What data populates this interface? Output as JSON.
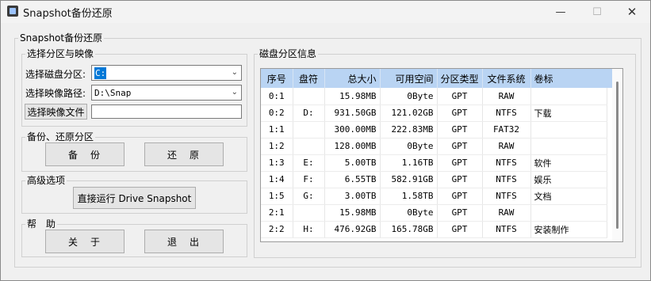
{
  "window": {
    "title": "Snapshot备份还原",
    "min_glyph": "—",
    "max_glyph": "☐",
    "close_glyph": "✕"
  },
  "main_group_title": "Snapshot备份还原",
  "select_group": {
    "title": "选择分区与映像",
    "partition_label": "选择磁盘分区:",
    "partition_value": "C:",
    "image_path_label": "选择映像路径:",
    "image_path_value": "D:\\Snap",
    "choose_file_button": "选择映像文件",
    "file_value": ""
  },
  "backup_group": {
    "title": "备份、还原分区",
    "backup_button": "备　份",
    "restore_button": "还　原"
  },
  "advanced_group": {
    "title": "高级选项",
    "run_button": "直接运行 Drive Snapshot"
  },
  "help_group": {
    "title": "帮　助",
    "about_button": "关　于",
    "exit_button": "退　出"
  },
  "disk_group": {
    "title": "磁盘分区信息",
    "columns": [
      "序号",
      "盘符",
      "总大小",
      "可用空间",
      "分区类型",
      "文件系统",
      "卷标"
    ],
    "rows": [
      [
        "0:1",
        "",
        "15.98MB",
        "0Byte",
        "GPT",
        "RAW",
        ""
      ],
      [
        "0:2",
        "D:",
        "931.50GB",
        "121.02GB",
        "GPT",
        "NTFS",
        "下载"
      ],
      [
        "1:1",
        "",
        "300.00MB",
        "222.83MB",
        "GPT",
        "FAT32",
        ""
      ],
      [
        "1:2",
        "",
        "128.00MB",
        "0Byte",
        "GPT",
        "RAW",
        ""
      ],
      [
        "1:3",
        "E:",
        "5.00TB",
        "1.16TB",
        "GPT",
        "NTFS",
        "软件"
      ],
      [
        "1:4",
        "F:",
        "6.55TB",
        "582.91GB",
        "GPT",
        "NTFS",
        "娱乐"
      ],
      [
        "1:5",
        "G:",
        "3.00TB",
        "1.58TB",
        "GPT",
        "NTFS",
        "文档"
      ],
      [
        "2:1",
        "",
        "15.98MB",
        "0Byte",
        "GPT",
        "RAW",
        ""
      ],
      [
        "2:2",
        "H:",
        "476.92GB",
        "165.78GB",
        "GPT",
        "NTFS",
        "安装制作"
      ]
    ]
  },
  "colors": {
    "header_bg": "#b9d4f3",
    "selection": "#0078d7",
    "window_bg": "#f0f0f0"
  }
}
